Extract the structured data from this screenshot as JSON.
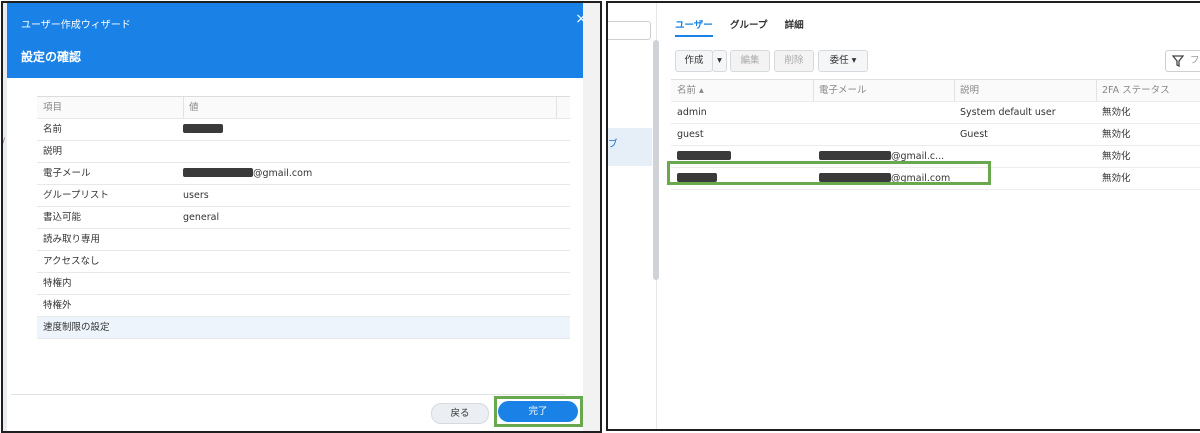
{
  "wizard": {
    "title": "ユーザー作成ウィザード",
    "close_glyph": "×",
    "heading": "設定の確認",
    "edge_glyph": "/",
    "table": {
      "col_key": "項目",
      "col_value": "値",
      "rows": [
        {
          "key": "名前",
          "value": "",
          "value_suffix": ""
        },
        {
          "key": "説明",
          "value": "",
          "value_suffix": ""
        },
        {
          "key": "電子メール",
          "value": "",
          "value_suffix": "@gmail.com"
        },
        {
          "key": "グループリスト",
          "value": "users",
          "value_suffix": ""
        },
        {
          "key": "書込可能",
          "value": "general",
          "value_suffix": ""
        },
        {
          "key": "読み取り専用",
          "value": "",
          "value_suffix": ""
        },
        {
          "key": "アクセスなし",
          "value": "",
          "value_suffix": ""
        },
        {
          "key": "特権内",
          "value": "",
          "value_suffix": ""
        },
        {
          "key": "特権外",
          "value": "",
          "value_suffix": ""
        },
        {
          "key": "速度制限の設定",
          "value": "",
          "value_suffix": ""
        }
      ]
    },
    "back_label": "戻る",
    "finish_label": "完了",
    "highlight_color": "#6aa84f",
    "accent_color": "#1a82e6"
  },
  "user_panel": {
    "side_glyph": "ブ",
    "tabs": [
      {
        "label": "ユーザー",
        "active": true
      },
      {
        "label": "グループ",
        "active": false
      },
      {
        "label": "詳細",
        "active": false
      }
    ],
    "toolbar": {
      "create_label": "作成",
      "create_caret": "▾",
      "edit_label": "編集",
      "delete_label": "削除",
      "delegate_label": "委任 ▾",
      "filter_placeholder": "フィ"
    },
    "columns": {
      "name": "名前 ▴",
      "email": "電子メール",
      "description": "説明",
      "twofa": "2FA ステータス"
    },
    "rows": [
      {
        "name": "admin",
        "email": "",
        "description": "System default user",
        "twofa": "無効化"
      },
      {
        "name": "guest",
        "email": "",
        "description": "Guest",
        "twofa": "無効化"
      },
      {
        "name": "",
        "email": "@gmail.c...",
        "description": "",
        "twofa": "無効化"
      },
      {
        "name": "",
        "email": "@gmail.com",
        "description": "",
        "twofa": "無効化"
      }
    ]
  }
}
